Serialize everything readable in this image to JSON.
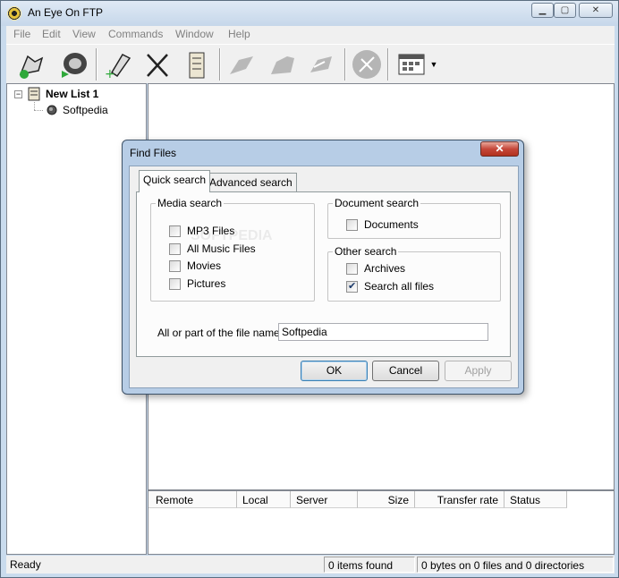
{
  "app": {
    "title": "An Eye On FTP"
  },
  "menu": [
    "File",
    "Edit",
    "View",
    "Commands",
    "Window",
    "Help"
  ],
  "toolbar": {
    "icons": [
      "connect-icon",
      "disconnect-icon",
      "add-site-icon",
      "cancel-icon",
      "queue-icon",
      "upload-icon",
      "download-icon",
      "transfer-icon",
      "stop-icon",
      "view-toggle-icon"
    ]
  },
  "tree": {
    "root": "New List 1",
    "expander": "−",
    "children": [
      "Softpedia"
    ]
  },
  "transfer_columns": [
    "Remote",
    "Local",
    "Server",
    "Size",
    "Transfer rate",
    "Status"
  ],
  "status": {
    "ready": "Ready",
    "items_found": "0 items found",
    "bytes": "0 bytes on 0 files and 0 directories"
  },
  "dialog": {
    "title": "Find Files",
    "close": "✕",
    "tabs": [
      "Quick search",
      "Advanced search"
    ],
    "watermark": "SOFTPEDIA",
    "media_search": {
      "label": "Media search",
      "items": [
        {
          "label": "MP3  Files",
          "checked": false
        },
        {
          "label": "All Music Files",
          "checked": false
        },
        {
          "label": "Movies",
          "checked": false
        },
        {
          "label": "Pictures",
          "checked": false
        }
      ]
    },
    "document_search": {
      "label": "Document search",
      "items": [
        {
          "label": "Documents",
          "checked": false
        }
      ]
    },
    "other_search": {
      "label": "Other search",
      "items": [
        {
          "label": "Archives",
          "checked": false
        },
        {
          "label": "Search all files",
          "checked": true
        }
      ]
    },
    "filename_label": "All or part of the file name:",
    "filename_value": "Softpedia",
    "buttons": {
      "ok": "OK",
      "cancel": "Cancel",
      "apply": "Apply"
    }
  }
}
